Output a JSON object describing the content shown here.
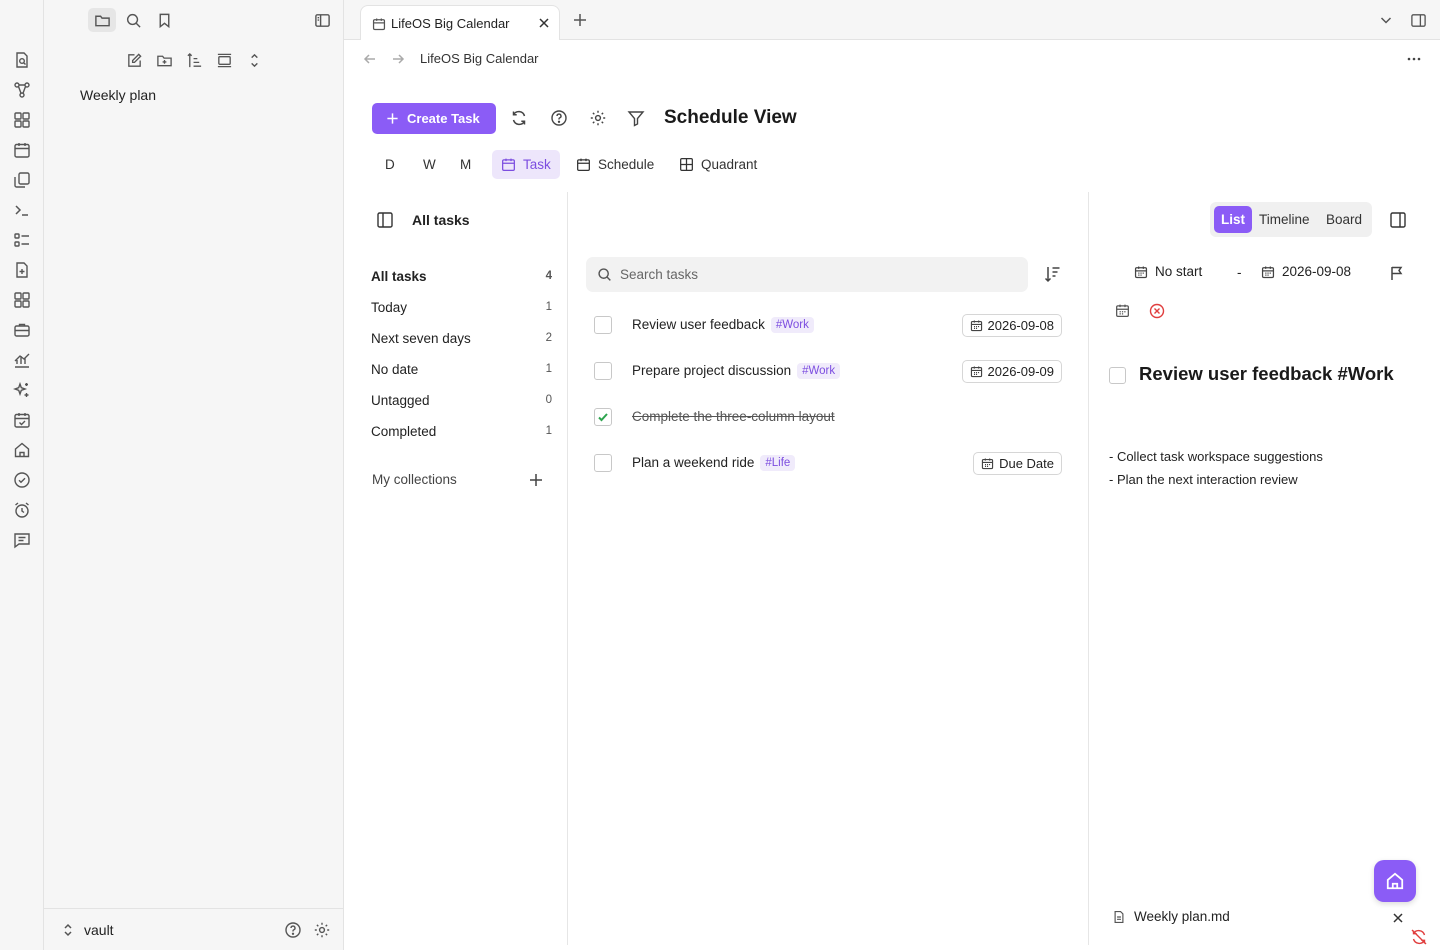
{
  "colors": {
    "accent": "#8b5cf6",
    "accent_light": "#ede6fb",
    "danger": "#e03e3e",
    "check": "#2da44e"
  },
  "ribbon": {
    "icons": [
      "file-search-icon",
      "graph-icon",
      "grid-icon",
      "calendar-icon",
      "copy-icon",
      "terminal-icon",
      "list-icon",
      "file-plus-icon",
      "layout-icon",
      "briefcase-icon",
      "chart-icon",
      "sparkle-icon",
      "calendar-check-icon",
      "home-icon",
      "check-circle-icon",
      "alarm-icon",
      "message-icon"
    ]
  },
  "sidebar": {
    "files": [
      "Weekly plan"
    ],
    "vault_name": "vault"
  },
  "tabbar": {
    "tab_title": "LifeOS Big Calendar"
  },
  "nav": {
    "breadcrumb": "LifeOS Big Calendar"
  },
  "toolbar": {
    "create_label": "Create Task",
    "view_title": "Schedule View",
    "tabs": [
      {
        "label": "D",
        "active": false
      },
      {
        "label": "W",
        "active": false
      },
      {
        "label": "M",
        "active": false
      },
      {
        "label": "Task",
        "active": true
      },
      {
        "label": "Schedule",
        "active": false
      },
      {
        "label": "Quadrant",
        "active": false
      }
    ]
  },
  "lists": {
    "header": "All tasks",
    "items": [
      {
        "label": "All tasks",
        "count": "4"
      },
      {
        "label": "Today",
        "count": "1"
      },
      {
        "label": "Next seven days",
        "count": "2"
      },
      {
        "label": "No date",
        "count": "1"
      },
      {
        "label": "Untagged",
        "count": "0"
      },
      {
        "label": "Completed",
        "count": "1"
      }
    ],
    "collections_label": "My collections"
  },
  "tasks": {
    "search_placeholder": "Search tasks",
    "items": [
      {
        "title": "Review user feedback",
        "tag": "#Work",
        "due": "2026-09-08",
        "done": false
      },
      {
        "title": "Prepare project discussion",
        "tag": "#Work",
        "due": "2026-09-09",
        "done": false
      },
      {
        "title": "Complete the three-column layout",
        "tag": "",
        "due": "",
        "done": true
      },
      {
        "title": "Plan a weekend ride",
        "tag": "#Life",
        "due": "Due Date",
        "done": false
      }
    ]
  },
  "detail": {
    "view_options": [
      "List",
      "Timeline",
      "Board"
    ],
    "active_view": "List",
    "start": "No start",
    "separator": "-",
    "end": "2026-09-08",
    "title": "Review user feedback #Work",
    "notes": [
      "- Collect task workspace suggestions",
      "- Plan the next interaction review"
    ],
    "file_name": "Weekly plan.md"
  }
}
